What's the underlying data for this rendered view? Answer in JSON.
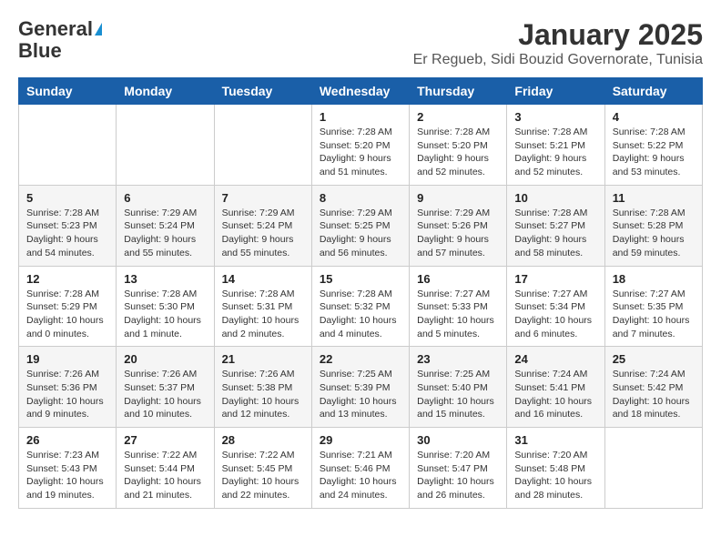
{
  "logo": {
    "line1": "General",
    "line2": "Blue"
  },
  "title": "January 2025",
  "subtitle": "Er Regueb, Sidi Bouzid Governorate, Tunisia",
  "weekdays": [
    "Sunday",
    "Monday",
    "Tuesday",
    "Wednesday",
    "Thursday",
    "Friday",
    "Saturday"
  ],
  "weeks": [
    [
      {
        "day": "",
        "info": ""
      },
      {
        "day": "",
        "info": ""
      },
      {
        "day": "",
        "info": ""
      },
      {
        "day": "1",
        "info": "Sunrise: 7:28 AM\nSunset: 5:20 PM\nDaylight: 9 hours\nand 51 minutes."
      },
      {
        "day": "2",
        "info": "Sunrise: 7:28 AM\nSunset: 5:20 PM\nDaylight: 9 hours\nand 52 minutes."
      },
      {
        "day": "3",
        "info": "Sunrise: 7:28 AM\nSunset: 5:21 PM\nDaylight: 9 hours\nand 52 minutes."
      },
      {
        "day": "4",
        "info": "Sunrise: 7:28 AM\nSunset: 5:22 PM\nDaylight: 9 hours\nand 53 minutes."
      }
    ],
    [
      {
        "day": "5",
        "info": "Sunrise: 7:28 AM\nSunset: 5:23 PM\nDaylight: 9 hours\nand 54 minutes."
      },
      {
        "day": "6",
        "info": "Sunrise: 7:29 AM\nSunset: 5:24 PM\nDaylight: 9 hours\nand 55 minutes."
      },
      {
        "day": "7",
        "info": "Sunrise: 7:29 AM\nSunset: 5:24 PM\nDaylight: 9 hours\nand 55 minutes."
      },
      {
        "day": "8",
        "info": "Sunrise: 7:29 AM\nSunset: 5:25 PM\nDaylight: 9 hours\nand 56 minutes."
      },
      {
        "day": "9",
        "info": "Sunrise: 7:29 AM\nSunset: 5:26 PM\nDaylight: 9 hours\nand 57 minutes."
      },
      {
        "day": "10",
        "info": "Sunrise: 7:28 AM\nSunset: 5:27 PM\nDaylight: 9 hours\nand 58 minutes."
      },
      {
        "day": "11",
        "info": "Sunrise: 7:28 AM\nSunset: 5:28 PM\nDaylight: 9 hours\nand 59 minutes."
      }
    ],
    [
      {
        "day": "12",
        "info": "Sunrise: 7:28 AM\nSunset: 5:29 PM\nDaylight: 10 hours\nand 0 minutes."
      },
      {
        "day": "13",
        "info": "Sunrise: 7:28 AM\nSunset: 5:30 PM\nDaylight: 10 hours\nand 1 minute."
      },
      {
        "day": "14",
        "info": "Sunrise: 7:28 AM\nSunset: 5:31 PM\nDaylight: 10 hours\nand 2 minutes."
      },
      {
        "day": "15",
        "info": "Sunrise: 7:28 AM\nSunset: 5:32 PM\nDaylight: 10 hours\nand 4 minutes."
      },
      {
        "day": "16",
        "info": "Sunrise: 7:27 AM\nSunset: 5:33 PM\nDaylight: 10 hours\nand 5 minutes."
      },
      {
        "day": "17",
        "info": "Sunrise: 7:27 AM\nSunset: 5:34 PM\nDaylight: 10 hours\nand 6 minutes."
      },
      {
        "day": "18",
        "info": "Sunrise: 7:27 AM\nSunset: 5:35 PM\nDaylight: 10 hours\nand 7 minutes."
      }
    ],
    [
      {
        "day": "19",
        "info": "Sunrise: 7:26 AM\nSunset: 5:36 PM\nDaylight: 10 hours\nand 9 minutes."
      },
      {
        "day": "20",
        "info": "Sunrise: 7:26 AM\nSunset: 5:37 PM\nDaylight: 10 hours\nand 10 minutes."
      },
      {
        "day": "21",
        "info": "Sunrise: 7:26 AM\nSunset: 5:38 PM\nDaylight: 10 hours\nand 12 minutes."
      },
      {
        "day": "22",
        "info": "Sunrise: 7:25 AM\nSunset: 5:39 PM\nDaylight: 10 hours\nand 13 minutes."
      },
      {
        "day": "23",
        "info": "Sunrise: 7:25 AM\nSunset: 5:40 PM\nDaylight: 10 hours\nand 15 minutes."
      },
      {
        "day": "24",
        "info": "Sunrise: 7:24 AM\nSunset: 5:41 PM\nDaylight: 10 hours\nand 16 minutes."
      },
      {
        "day": "25",
        "info": "Sunrise: 7:24 AM\nSunset: 5:42 PM\nDaylight: 10 hours\nand 18 minutes."
      }
    ],
    [
      {
        "day": "26",
        "info": "Sunrise: 7:23 AM\nSunset: 5:43 PM\nDaylight: 10 hours\nand 19 minutes."
      },
      {
        "day": "27",
        "info": "Sunrise: 7:22 AM\nSunset: 5:44 PM\nDaylight: 10 hours\nand 21 minutes."
      },
      {
        "day": "28",
        "info": "Sunrise: 7:22 AM\nSunset: 5:45 PM\nDaylight: 10 hours\nand 22 minutes."
      },
      {
        "day": "29",
        "info": "Sunrise: 7:21 AM\nSunset: 5:46 PM\nDaylight: 10 hours\nand 24 minutes."
      },
      {
        "day": "30",
        "info": "Sunrise: 7:20 AM\nSunset: 5:47 PM\nDaylight: 10 hours\nand 26 minutes."
      },
      {
        "day": "31",
        "info": "Sunrise: 7:20 AM\nSunset: 5:48 PM\nDaylight: 10 hours\nand 28 minutes."
      },
      {
        "day": "",
        "info": ""
      }
    ]
  ]
}
